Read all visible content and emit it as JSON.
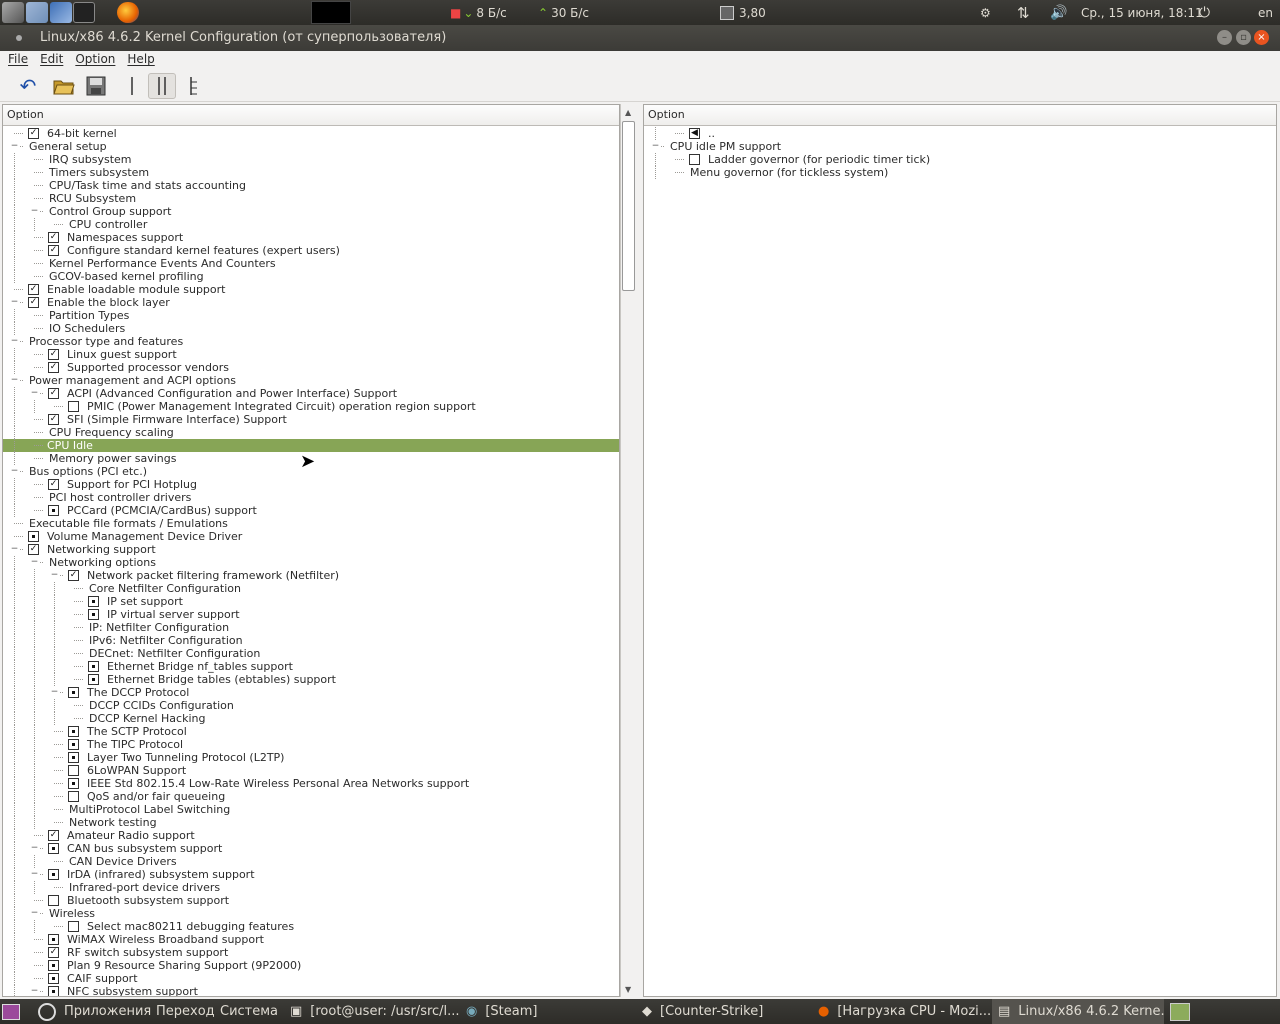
{
  "panel": {
    "net_down": "8 Б/с",
    "net_up": "30 Б/с",
    "cpu": "3,80",
    "clock": "Ср., 15 июня, 18:11",
    "lang": "en"
  },
  "window": {
    "title": "Linux/x86 4.6.2 Kernel Configuration (от суперпользователя)"
  },
  "menu": {
    "file": "File",
    "edit": "Edit",
    "option": "Option",
    "help": "Help"
  },
  "toolbar": {
    "icons": [
      "undo-icon",
      "open-icon",
      "save-icon",
      "single-view-icon",
      "split-view-icon",
      "full-view-icon"
    ]
  },
  "left_header": "Option",
  "right_header": "Option",
  "left_rows": [
    {
      "l": 0,
      "e": "",
      "c": "check",
      "t": "64-bit kernel"
    },
    {
      "l": 0,
      "e": "-",
      "c": "",
      "t": "General setup"
    },
    {
      "l": 1,
      "e": "",
      "c": "",
      "t": "IRQ subsystem"
    },
    {
      "l": 1,
      "e": "",
      "c": "",
      "t": "Timers subsystem"
    },
    {
      "l": 1,
      "e": "",
      "c": "",
      "t": "CPU/Task time and stats accounting"
    },
    {
      "l": 1,
      "e": "",
      "c": "",
      "t": "RCU Subsystem"
    },
    {
      "l": 1,
      "e": "-",
      "c": "",
      "t": "Control Group support"
    },
    {
      "l": 2,
      "e": "",
      "c": "",
      "t": "CPU controller"
    },
    {
      "l": 1,
      "e": "",
      "c": "check",
      "t": "Namespaces support"
    },
    {
      "l": 1,
      "e": "",
      "c": "check",
      "t": "Configure standard kernel features (expert users)"
    },
    {
      "l": 1,
      "e": "",
      "c": "",
      "t": "Kernel Performance Events And Counters"
    },
    {
      "l": 1,
      "e": "",
      "c": "",
      "t": "GCOV-based kernel profiling"
    },
    {
      "l": 0,
      "e": "",
      "c": "check",
      "t": "Enable loadable module support"
    },
    {
      "l": 0,
      "e": "-",
      "c": "check",
      "t": "Enable the block layer"
    },
    {
      "l": 1,
      "e": "",
      "c": "",
      "t": "Partition Types"
    },
    {
      "l": 1,
      "e": "",
      "c": "",
      "t": "IO Schedulers"
    },
    {
      "l": 0,
      "e": "-",
      "c": "",
      "t": "Processor type and features"
    },
    {
      "l": 1,
      "e": "",
      "c": "check",
      "t": "Linux guest support"
    },
    {
      "l": 1,
      "e": "",
      "c": "check",
      "t": "Supported processor vendors"
    },
    {
      "l": 0,
      "e": "-",
      "c": "",
      "t": "Power management and ACPI options"
    },
    {
      "l": 1,
      "e": "-",
      "c": "check",
      "t": "ACPI (Advanced Configuration and Power Interface) Support"
    },
    {
      "l": 2,
      "e": "",
      "c": "empty",
      "t": "PMIC (Power Management Integrated Circuit) operation region support"
    },
    {
      "l": 1,
      "e": "",
      "c": "check",
      "t": "SFI (Simple Firmware Interface) Support"
    },
    {
      "l": 1,
      "e": "",
      "c": "",
      "t": "CPU Frequency scaling"
    },
    {
      "l": 1,
      "e": "",
      "c": "",
      "t": "CPU Idle",
      "sel": true
    },
    {
      "l": 1,
      "e": "",
      "c": "",
      "t": "Memory power savings"
    },
    {
      "l": 0,
      "e": "-",
      "c": "",
      "t": "Bus options (PCI etc.)"
    },
    {
      "l": 1,
      "e": "",
      "c": "check",
      "t": "Support for PCI Hotplug"
    },
    {
      "l": 1,
      "e": "",
      "c": "",
      "t": "PCI host controller drivers"
    },
    {
      "l": 1,
      "e": "",
      "c": "dot",
      "t": "PCCard (PCMCIA/CardBus) support"
    },
    {
      "l": 0,
      "e": "",
      "c": "",
      "t": "Executable file formats / Emulations"
    },
    {
      "l": 0,
      "e": "",
      "c": "dot",
      "t": "Volume Management Device Driver"
    },
    {
      "l": 0,
      "e": "-",
      "c": "check",
      "t": "Networking support"
    },
    {
      "l": 1,
      "e": "-",
      "c": "",
      "t": "Networking options"
    },
    {
      "l": 2,
      "e": "-",
      "c": "check",
      "t": "Network packet filtering framework (Netfilter)"
    },
    {
      "l": 3,
      "e": "",
      "c": "",
      "t": "Core Netfilter Configuration"
    },
    {
      "l": 3,
      "e": "",
      "c": "dot",
      "t": "IP set support"
    },
    {
      "l": 3,
      "e": "",
      "c": "dot",
      "t": "IP virtual server support"
    },
    {
      "l": 3,
      "e": "",
      "c": "",
      "t": "IP: Netfilter Configuration"
    },
    {
      "l": 3,
      "e": "",
      "c": "",
      "t": "IPv6: Netfilter Configuration"
    },
    {
      "l": 3,
      "e": "",
      "c": "",
      "t": "DECnet: Netfilter Configuration"
    },
    {
      "l": 3,
      "e": "",
      "c": "dot",
      "t": "Ethernet Bridge nf_tables support"
    },
    {
      "l": 3,
      "e": "",
      "c": "dot",
      "t": "Ethernet Bridge tables (ebtables) support"
    },
    {
      "l": 2,
      "e": "-",
      "c": "dot",
      "t": "The DCCP Protocol"
    },
    {
      "l": 3,
      "e": "",
      "c": "",
      "t": "DCCP CCIDs Configuration"
    },
    {
      "l": 3,
      "e": "",
      "c": "",
      "t": "DCCP Kernel Hacking"
    },
    {
      "l": 2,
      "e": "",
      "c": "dot",
      "t": "The SCTP Protocol"
    },
    {
      "l": 2,
      "e": "",
      "c": "dot",
      "t": "The TIPC Protocol"
    },
    {
      "l": 2,
      "e": "",
      "c": "dot",
      "t": "Layer Two Tunneling Protocol (L2TP)"
    },
    {
      "l": 2,
      "e": "",
      "c": "empty",
      "t": "6LoWPAN Support"
    },
    {
      "l": 2,
      "e": "",
      "c": "dot",
      "t": "IEEE Std 802.15.4 Low-Rate Wireless Personal Area Networks support"
    },
    {
      "l": 2,
      "e": "",
      "c": "empty",
      "t": "QoS and/or fair queueing"
    },
    {
      "l": 2,
      "e": "",
      "c": "",
      "t": "MultiProtocol Label Switching"
    },
    {
      "l": 2,
      "e": "",
      "c": "",
      "t": "Network testing"
    },
    {
      "l": 1,
      "e": "",
      "c": "check",
      "t": "Amateur Radio support"
    },
    {
      "l": 1,
      "e": "-",
      "c": "dot",
      "t": "CAN bus subsystem support"
    },
    {
      "l": 2,
      "e": "",
      "c": "",
      "t": "CAN Device Drivers"
    },
    {
      "l": 1,
      "e": "-",
      "c": "dot",
      "t": "IrDA (infrared) subsystem support"
    },
    {
      "l": 2,
      "e": "",
      "c": "",
      "t": "Infrared-port device drivers"
    },
    {
      "l": 1,
      "e": "",
      "c": "empty",
      "t": "Bluetooth subsystem support"
    },
    {
      "l": 1,
      "e": "-",
      "c": "",
      "t": "Wireless"
    },
    {
      "l": 2,
      "e": "",
      "c": "empty",
      "t": "Select mac80211 debugging features"
    },
    {
      "l": 1,
      "e": "",
      "c": "dot",
      "t": "WiMAX Wireless Broadband support"
    },
    {
      "l": 1,
      "e": "",
      "c": "check",
      "t": "RF switch subsystem support"
    },
    {
      "l": 1,
      "e": "",
      "c": "dot",
      "t": "Plan 9 Resource Sharing Support (9P2000)"
    },
    {
      "l": 1,
      "e": "",
      "c": "dot",
      "t": "CAIF support"
    },
    {
      "l": 1,
      "e": "-",
      "c": "dot",
      "t": "NFC subsystem support"
    }
  ],
  "right_rows": [
    {
      "l": 1,
      "e": "",
      "c": "back",
      "t": ".."
    },
    {
      "l": 0,
      "e": "-",
      "c": "",
      "t": "CPU idle PM support"
    },
    {
      "l": 1,
      "e": "",
      "c": "empty",
      "t": "Ladder governor (for periodic timer tick)"
    },
    {
      "l": 1,
      "e": "",
      "c": "",
      "t": "Menu governor (for tickless system)"
    }
  ],
  "taskbar": {
    "apps": "Приложения",
    "places": "Переход",
    "system": "Система",
    "tasks": [
      "[root@user: /usr/src/l...",
      "[Steam]",
      "[Counter-Strike]",
      "[Нагрузка CPU - Mozi...",
      "Linux/x86 4.6.2 Kerne..."
    ]
  },
  "colors": {
    "selection": "#87a556",
    "panel": "#3c3b37",
    "accent": "#dd4814"
  }
}
